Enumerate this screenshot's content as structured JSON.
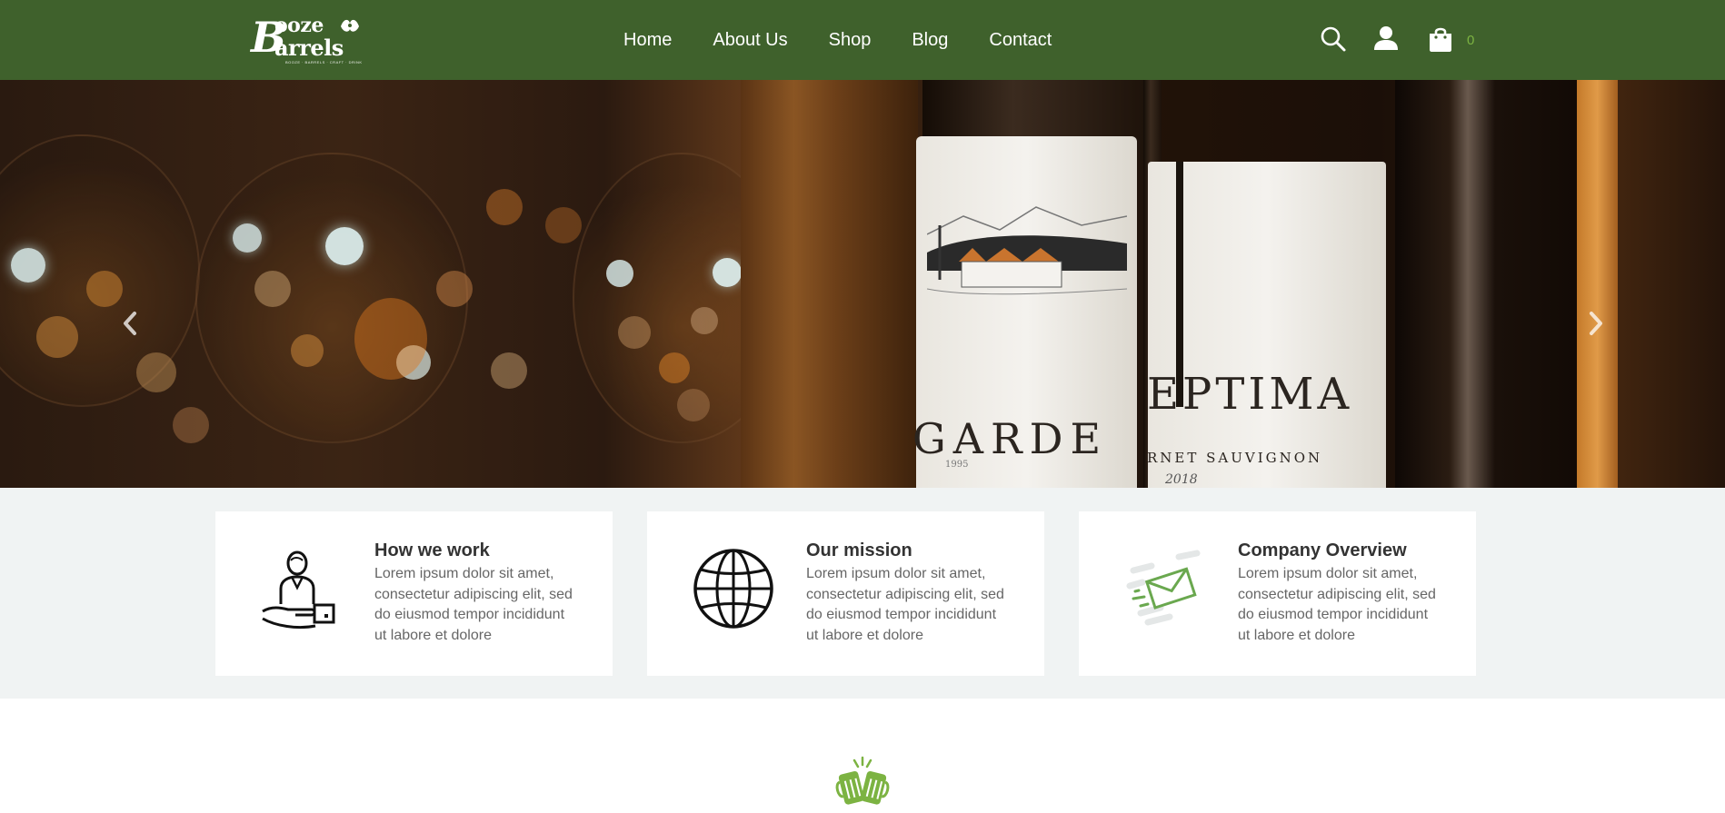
{
  "brand": {
    "logo_line1": "ooze",
    "logo_line2": "arrels",
    "logo_initial": "B",
    "logo_tagline": "BOOZE · BARRELS · CRAFT · DRINK"
  },
  "nav": {
    "items": [
      "Home",
      "About Us",
      "Shop",
      "Blog",
      "Contact"
    ]
  },
  "header_icons": {
    "search": "search-icon",
    "account": "user-icon",
    "cart": "shopping-bag-icon",
    "cart_count": "0"
  },
  "hero": {
    "label_left": "GARDE",
    "label_left_small": "1995",
    "label_right": "EPTIMA",
    "label_right_sub": "RNET SAUVIGNON",
    "label_right_year": "2018",
    "prev_icon": "chevron-left-icon",
    "next_icon": "chevron-right-icon"
  },
  "features": [
    {
      "title": "How we work",
      "text": "Lorem ipsum dolor sit amet, consectetur adipiscing elit, sed do eiusmod tempor incididunt ut labore et dolore",
      "icon": "person-delivery-icon"
    },
    {
      "title": "Our mission",
      "text": "Lorem ipsum dolor sit amet, consectetur adipiscing elit, sed do eiusmod tempor incididunt ut labore et dolore",
      "icon": "globe-icon"
    },
    {
      "title": "Company Overview",
      "text": "Lorem ipsum dolor sit amet, consectetur adipiscing elit, sed do eiusmod tempor incididunt ut labore et dolore",
      "icon": "envelope-icon"
    }
  ],
  "colors": {
    "header_bg": "#3f612c",
    "accent": "#7cb342",
    "features_bg": "#f0f3f3"
  },
  "section_icon": "beer-cheers-icon"
}
